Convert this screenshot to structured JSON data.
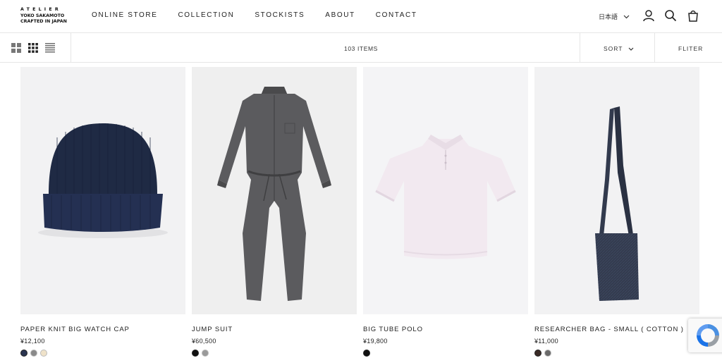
{
  "brand": {
    "line1": "ATELIER",
    "line2": "YOKO SAKAMOTO",
    "line3": "CRAFTED IN JAPAN"
  },
  "nav": {
    "items": [
      "ONLINE STORE",
      "COLLECTION",
      "STOCKISTS",
      "ABOUT",
      "CONTACT"
    ]
  },
  "header": {
    "language": "日本語"
  },
  "toolbar": {
    "items_count": "103 ITEMS",
    "sort_label": "SORT",
    "filter_label": "FLITER"
  },
  "products": [
    {
      "name": "PAPER KNIT BIG WATCH CAP",
      "price": "¥12,100",
      "swatches": [
        "#2b3550",
        "#8a8a8a",
        "#efe2c9"
      ],
      "image_icon": "navy-knit-beanie"
    },
    {
      "name": "JUMP SUIT",
      "price": "¥60,500",
      "swatches": [
        "#111111",
        "#9a9a9a"
      ],
      "image_icon": "grey-jumpsuit"
    },
    {
      "name": "BIG TUBE POLO",
      "price": "¥19,800",
      "swatches": [
        "#111111"
      ],
      "image_icon": "pink-polo-shirt"
    },
    {
      "name": "RESEARCHER BAG - SMALL ( COTTON )",
      "price": "¥11,000",
      "swatches": [
        "#3a2a26",
        "#6a6a6a"
      ],
      "image_icon": "navy-shoulder-bag"
    }
  ],
  "colors": {
    "text": "#222222",
    "divider": "#e6e6e6",
    "image_bg": "#f3f3f4"
  }
}
